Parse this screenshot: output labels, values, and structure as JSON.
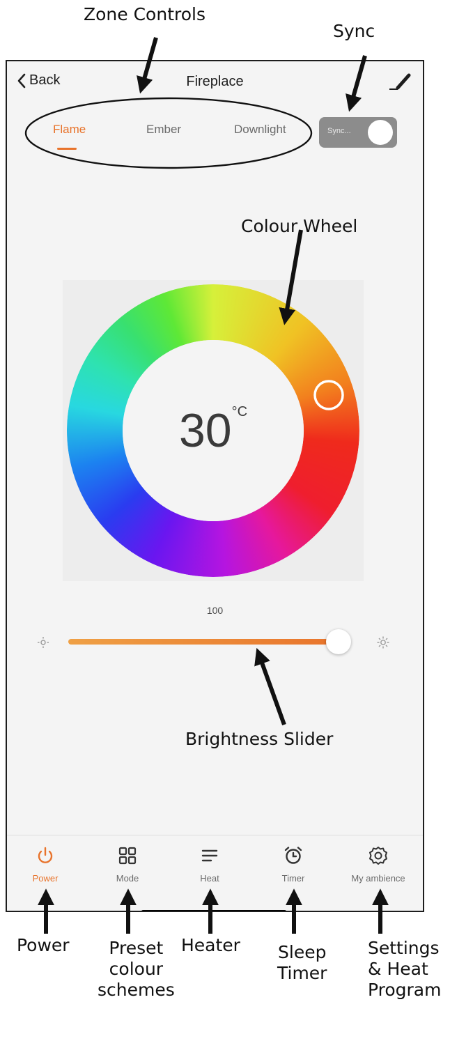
{
  "annotations": {
    "zone_controls": "Zone Controls",
    "sync": "Sync",
    "colour_wheel": "Colour Wheel",
    "brightness_slider": "Brightness Slider",
    "power": "Power",
    "preset_line1": "Preset",
    "preset_line2": "colour",
    "preset_line3": "schemes",
    "heater": "Heater",
    "sleep_line1": "Sleep",
    "sleep_line2": "Timer",
    "settings_line1": "Settings",
    "settings_line2": "& Heat",
    "settings_line3": "Program"
  },
  "nav": {
    "back_label": "Back",
    "title": "Fireplace",
    "edit_icon": "pen-icon"
  },
  "tabs": [
    {
      "label": "Flame",
      "active": true
    },
    {
      "label": "Ember",
      "active": false
    },
    {
      "label": "Downlight",
      "active": false
    }
  ],
  "sync": {
    "label": "Sync...",
    "on": true
  },
  "wheel": {
    "temperature": "30",
    "unit": "°C",
    "selected_hue": "red"
  },
  "brightness": {
    "value": "100",
    "fraction": 1.0
  },
  "tabbar": [
    {
      "label": "Power",
      "icon": "power-icon",
      "active": true
    },
    {
      "label": "Mode",
      "icon": "grid-icon",
      "active": false
    },
    {
      "label": "Heat",
      "icon": "lines-icon",
      "active": false
    },
    {
      "label": "Timer",
      "icon": "alarm-clock-icon",
      "active": false
    },
    {
      "label": "My ambience",
      "icon": "gear-icon",
      "active": false
    }
  ],
  "colors": {
    "accent": "#e8732b",
    "background": "#f4f4f4",
    "toggle": "#8c8c8c"
  }
}
